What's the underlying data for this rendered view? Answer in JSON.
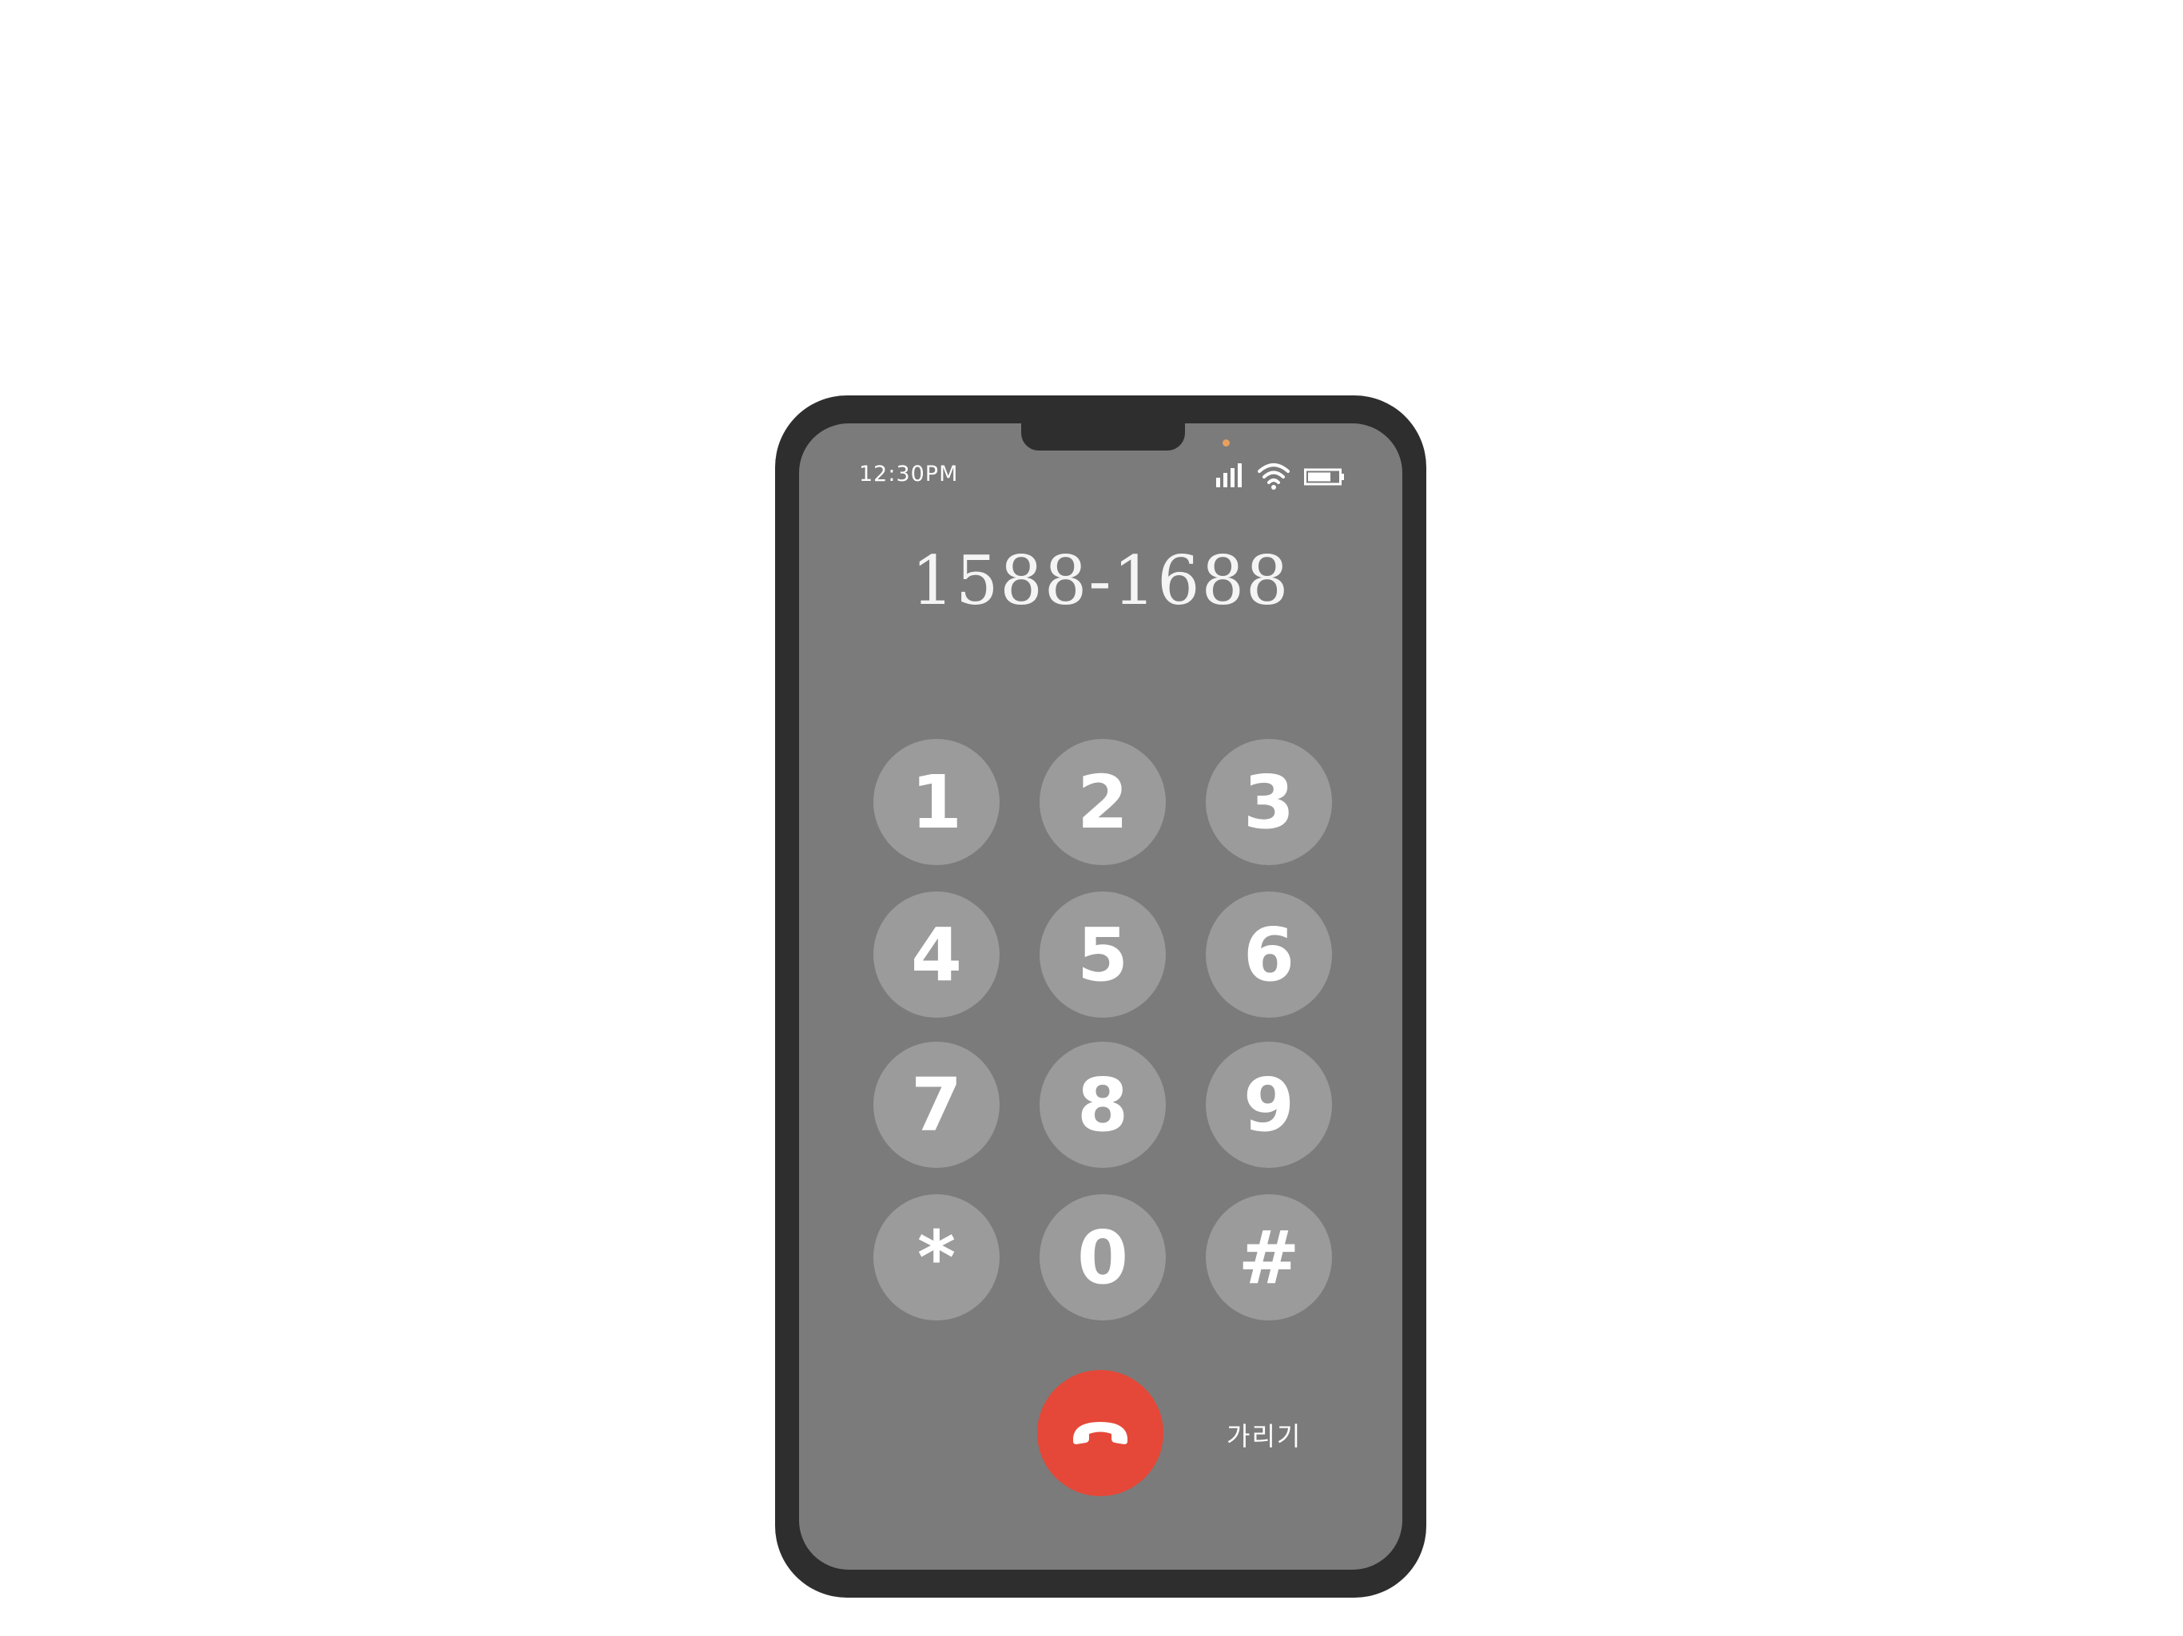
{
  "status_bar": {
    "time": "12:30PM",
    "icons": [
      "signal-icon",
      "wifi-icon",
      "battery-icon"
    ],
    "camera_indicator_color": "#e8a060"
  },
  "dialer": {
    "dialed_number": "1588-1688",
    "keys": [
      "1",
      "2",
      "3",
      "4",
      "5",
      "6",
      "7",
      "8",
      "9",
      "*",
      "0",
      "#"
    ],
    "end_call_icon": "phone-hangup-icon",
    "hide_label": "가리기"
  },
  "colors": {
    "frame": "#2e2e2e",
    "screen": "#7b7b7b",
    "key": "#9b9b9b",
    "end_call": "#e54838",
    "text": "#ffffff"
  }
}
